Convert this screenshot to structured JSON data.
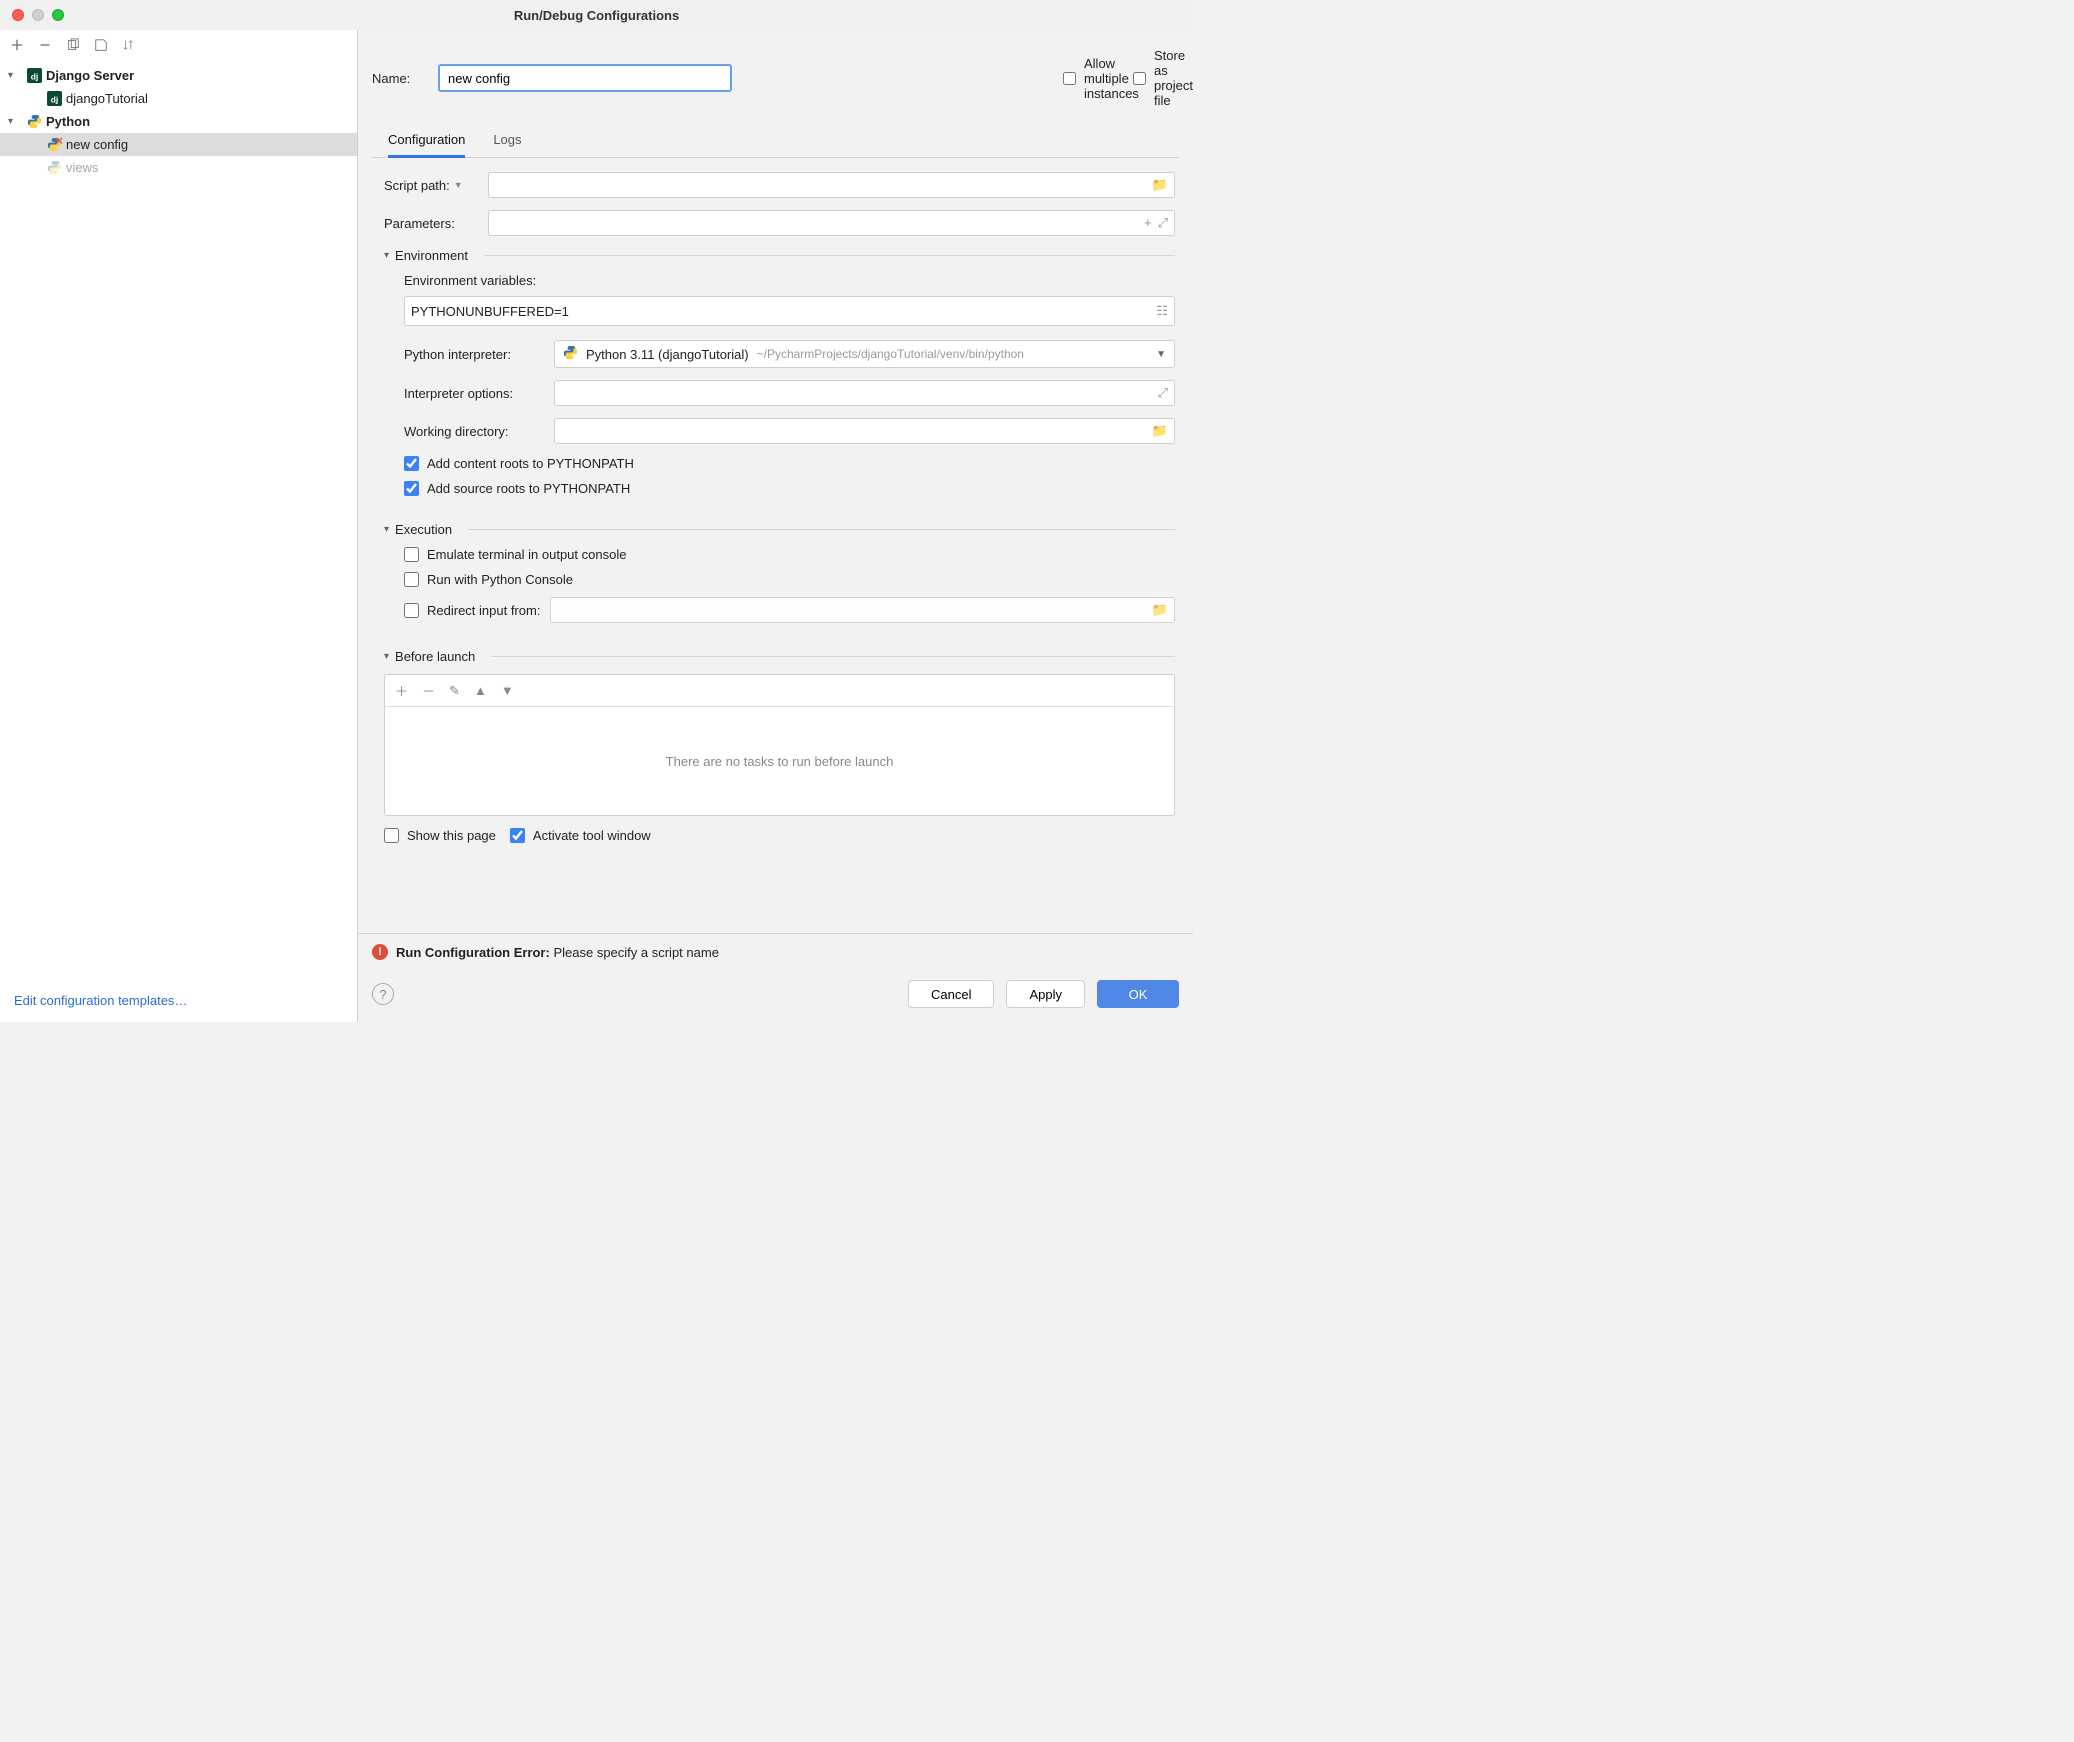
{
  "title": "Run/Debug Configurations",
  "sidebar": {
    "groups": [
      {
        "label": "Django Server",
        "iconName": "django-icon",
        "children": [
          {
            "label": "djangoTutorial",
            "iconName": "django-icon"
          }
        ]
      },
      {
        "label": "Python",
        "iconName": "python-icon",
        "children": [
          {
            "label": "new config",
            "iconName": "python-missing-icon",
            "selected": true
          },
          {
            "label": "views",
            "iconName": "python-faded-icon",
            "faded": true
          }
        ]
      }
    ],
    "editTemplates": "Edit configuration templates…"
  },
  "form": {
    "nameLabel": "Name:",
    "nameValue": "new config",
    "allowMultiple": "Allow multiple instances",
    "storeAsProject": "Store as project file",
    "tabs": {
      "configuration": "Configuration",
      "logs": "Logs"
    },
    "scriptPathLabel": "Script path:",
    "parametersLabel": "Parameters:",
    "envSection": "Environment",
    "envVarsLabel": "Environment variables:",
    "envVarsValue": "PYTHONUNBUFFERED=1",
    "interpLabel": "Python interpreter:",
    "interpName": "Python 3.11 (djangoTutorial)",
    "interpPath": "~/PycharmProjects/djangoTutorial/venv/bin/python",
    "interpOptsLabel": "Interpreter options:",
    "workDirLabel": "Working directory:",
    "addContentRoots": "Add content roots to PYTHONPATH",
    "addSourceRoots": "Add source roots to PYTHONPATH",
    "execSection": "Execution",
    "emulateTerminal": "Emulate terminal in output console",
    "runPyConsole": "Run with Python Console",
    "redirectInput": "Redirect input from:",
    "beforeLaunchSection": "Before launch",
    "noTasks": "There are no tasks to run before launch",
    "showThisPage": "Show this page",
    "activateTool": "Activate tool window"
  },
  "error": {
    "label": "Run Configuration Error:",
    "msg": "Please specify a script name"
  },
  "buttons": {
    "cancel": "Cancel",
    "apply": "Apply",
    "ok": "OK"
  }
}
